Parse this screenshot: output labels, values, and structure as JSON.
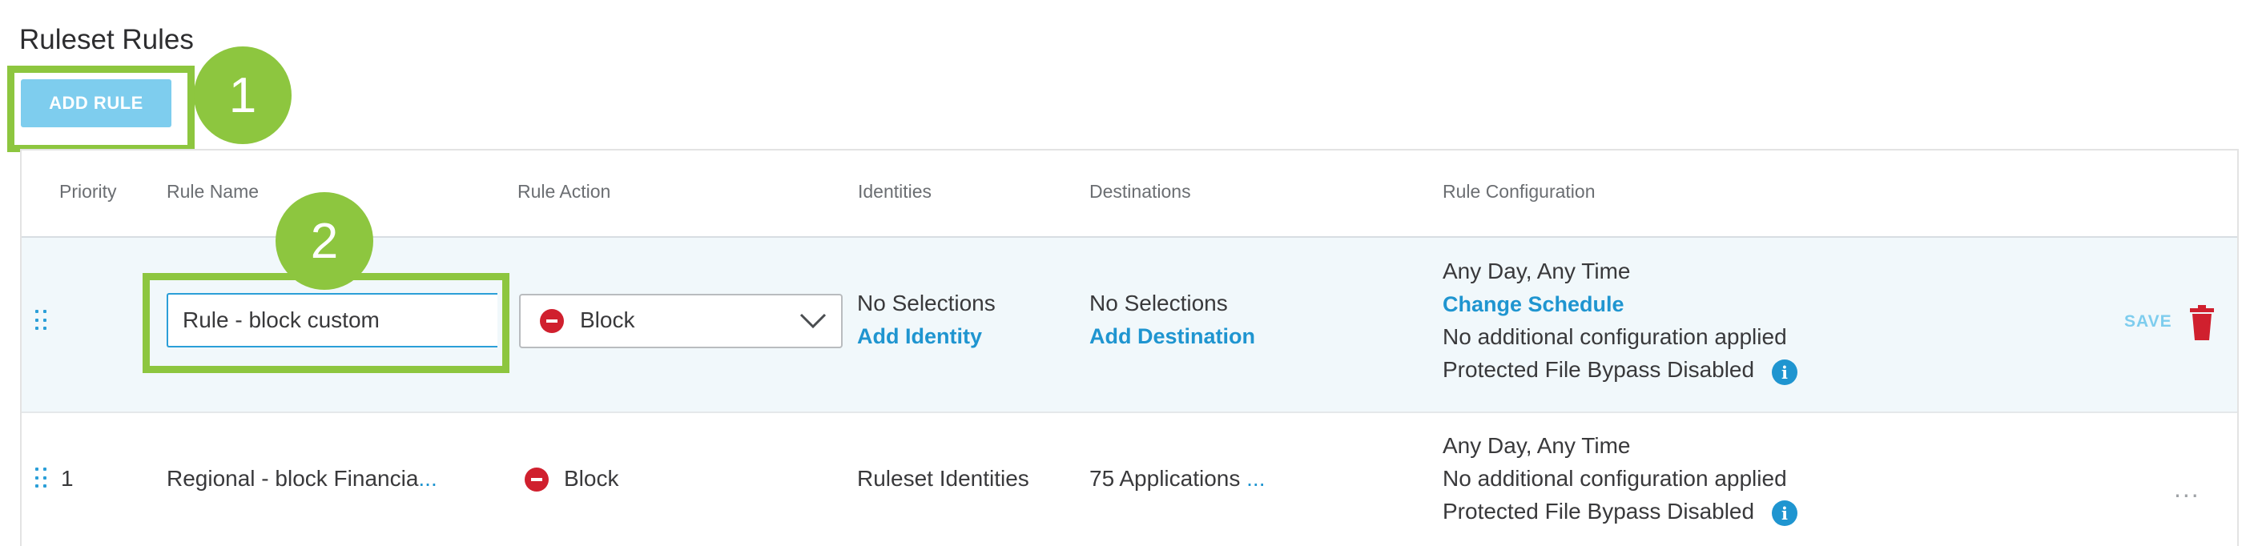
{
  "page": {
    "title": "Ruleset Rules"
  },
  "toolbar": {
    "add_rule_label": "ADD RULE"
  },
  "callouts": [
    "1",
    "2"
  ],
  "columns": [
    "Priority",
    "Rule Name",
    "Rule Action",
    "Identities",
    "Destinations",
    "Rule Configuration"
  ],
  "edit_row": {
    "rule_name_value": "Rule - block custom",
    "action_value": "Block",
    "identities_text": "No Selections",
    "identities_link": "Add Identity",
    "destinations_text": "No Selections",
    "destinations_link": "Add Destination",
    "config_schedule": "Any Day, Any Time",
    "config_link": "Change Schedule",
    "config_additional": "No additional configuration applied",
    "config_bypass": "Protected File Bypass Disabled",
    "save_label": "SAVE"
  },
  "rows": [
    {
      "priority": "1",
      "rule_name": "Regional - block Financia",
      "rule_name_more": "...",
      "action": "Block",
      "identities": "Ruleset Identities",
      "destinations": "75 Applications",
      "destinations_more": "...",
      "config_schedule": "Any Day, Any Time",
      "config_additional": "No additional configuration applied",
      "config_bypass": "Protected File Bypass Disabled",
      "more_label": "..."
    }
  ],
  "icons": {
    "info": "i",
    "drag": "drag-handle-icon",
    "trash": "trash-icon",
    "chevron": "chevron-down-icon",
    "block": "block-icon"
  },
  "colors": {
    "accent": "#1f95d0",
    "button": "#7ecdee",
    "highlight": "#8dc63f",
    "block": "#d0202e",
    "edit_row_bg": "#f1f8fb"
  }
}
